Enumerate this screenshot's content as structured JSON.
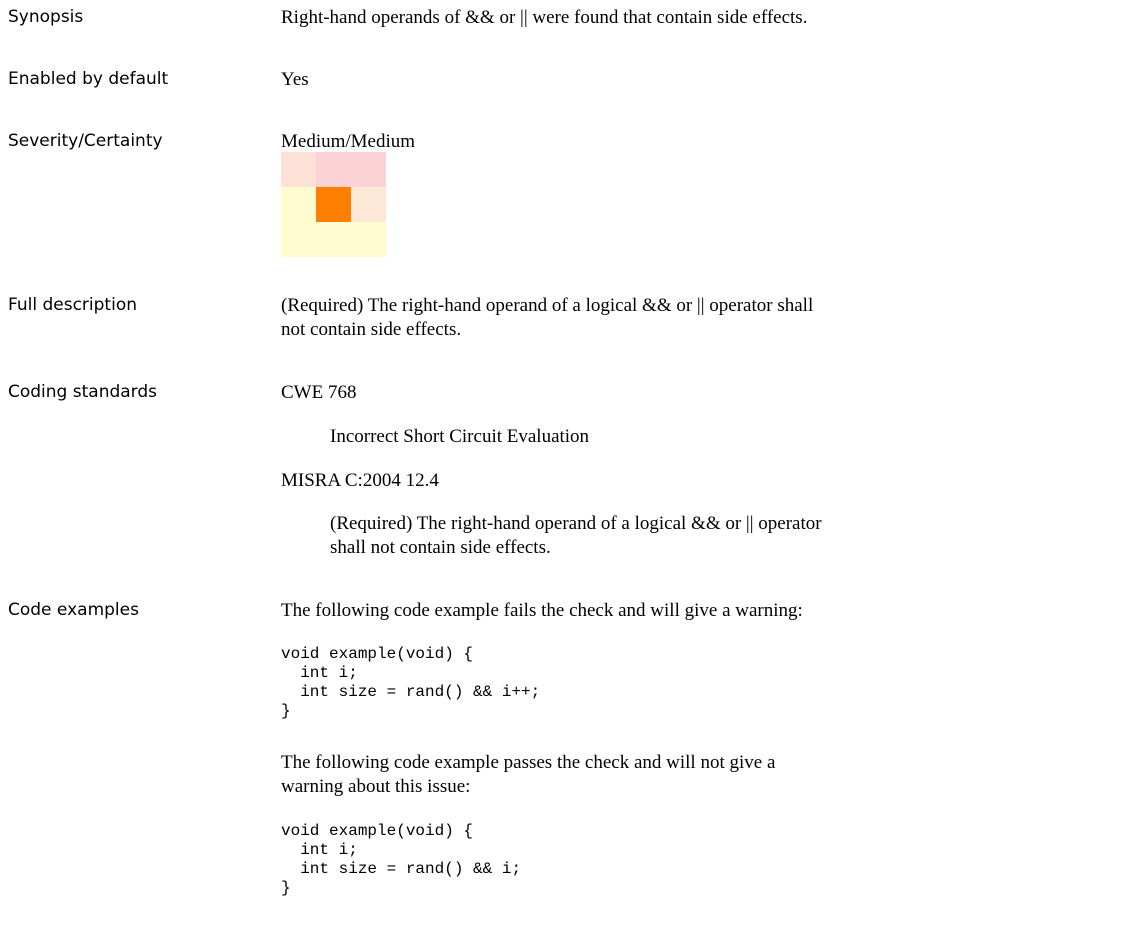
{
  "rows": {
    "synopsis": {
      "label": "Synopsis",
      "text": "Right-hand operands of && or || were found that contain side effects."
    },
    "enabled": {
      "label": "Enabled by default",
      "text": "Yes"
    },
    "severity": {
      "label": "Severity/Certainty",
      "text": "Medium/Medium",
      "matrix": [
        [
          "#fde0d6",
          "#fbd3d6",
          "#fbd3d6"
        ],
        [
          "#fffdd0",
          "#ff7f00",
          "#fde7d6"
        ],
        [
          "#fffdd0",
          "#fffdd0",
          "#fffdd0"
        ]
      ]
    },
    "full_description": {
      "label": "Full description",
      "text": "(Required) The right-hand operand of a logical && or || operator shall not contain side effects."
    },
    "coding_standards": {
      "label": "Coding standards",
      "items": [
        {
          "title": "CWE 768",
          "description": "Incorrect Short Circuit Evaluation"
        },
        {
          "title": "MISRA C:2004 12.4",
          "description": "(Required) The right-hand operand of a logical && or || operator shall not contain side effects."
        }
      ]
    },
    "code_examples": {
      "label": "Code examples",
      "fail_intro": "The following code example fails the check and will give a warning:",
      "fail_code": "void example(void) {\n  int i;\n  int size = rand() && i++;\n}",
      "pass_intro": "The following code example passes the check and will not give a warning about this issue:",
      "pass_code": "void example(void) {\n  int i;\n  int size = rand() && i;\n}"
    }
  }
}
